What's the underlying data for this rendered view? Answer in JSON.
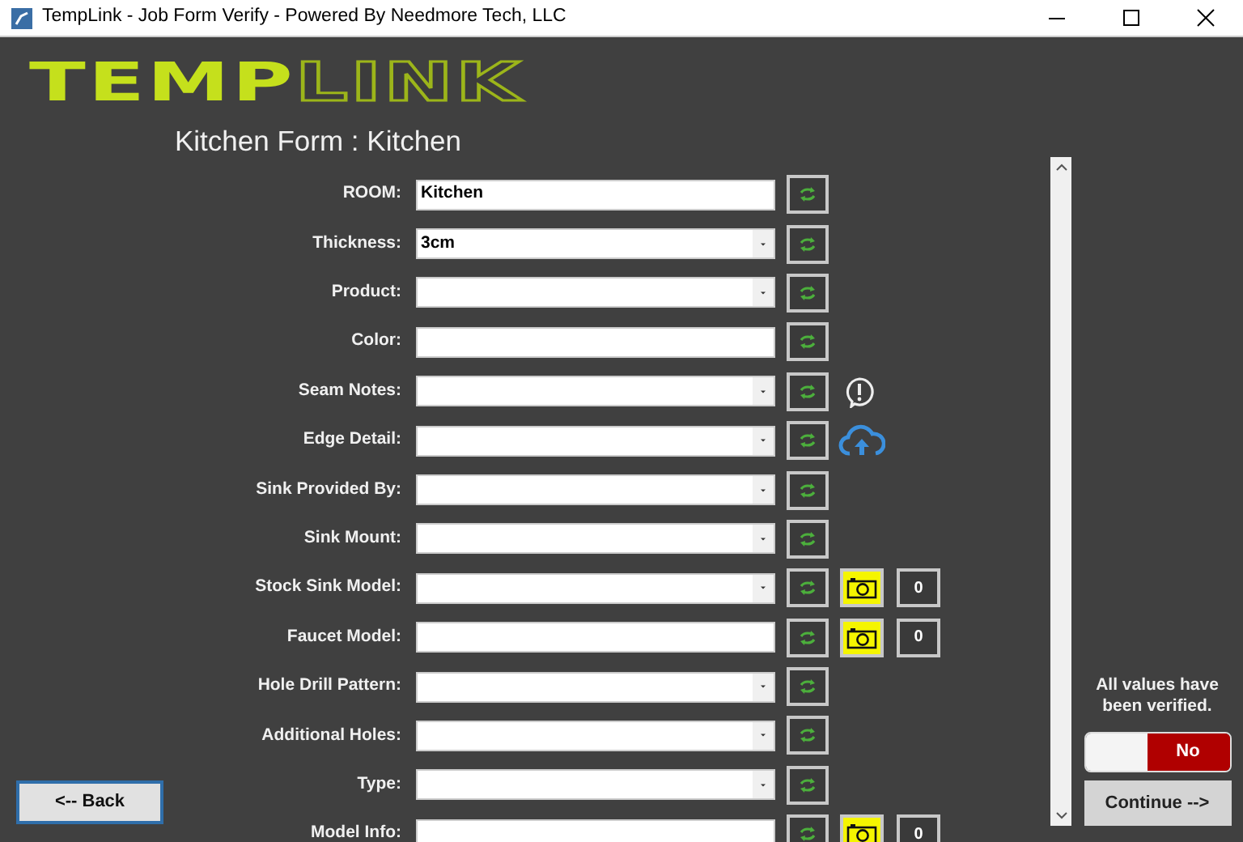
{
  "window": {
    "title": "TempLink - Job Form Verify - Powered By Needmore Tech, LLC"
  },
  "logo": {
    "filled_part": "TEMP",
    "outlined_part": "LINK"
  },
  "heading": "Kitchen Form : Kitchen",
  "rows": [
    {
      "label": "ROOM:",
      "kind": "text",
      "value": "Kitchen"
    },
    {
      "label": "Thickness:",
      "kind": "dropdown",
      "value": "3cm"
    },
    {
      "label": "Product:",
      "kind": "dropdown"
    },
    {
      "label": "Color:",
      "kind": "text"
    },
    {
      "label": "Seam Notes:",
      "kind": "dropdown",
      "extra": {
        "kind": "alert"
      }
    },
    {
      "label": "Edge Detail:",
      "kind": "dropdown",
      "extra": {
        "kind": "upload"
      }
    },
    {
      "label": "Sink Provided By:",
      "kind": "dropdown"
    },
    {
      "label": "Sink Mount:",
      "kind": "dropdown"
    },
    {
      "label": "Stock Sink Model:",
      "kind": "dropdown",
      "extra": {
        "kind": "photo",
        "count": "0"
      }
    },
    {
      "label": "Faucet Model:",
      "kind": "text",
      "extra": {
        "kind": "photo",
        "count": "0"
      }
    },
    {
      "label": "Hole Drill Pattern:",
      "kind": "dropdown"
    },
    {
      "label": "Additional Holes:",
      "kind": "dropdown"
    },
    {
      "label": "Type:",
      "kind": "dropdown"
    },
    {
      "label": "Model Info:",
      "kind": "text",
      "extra": {
        "kind": "photo",
        "count": "0"
      }
    }
  ],
  "verify": {
    "text": "All values have been verified.",
    "on": false,
    "off_label": "No"
  },
  "buttons": {
    "back": "<-- Back",
    "continue": "Continue -->"
  }
}
